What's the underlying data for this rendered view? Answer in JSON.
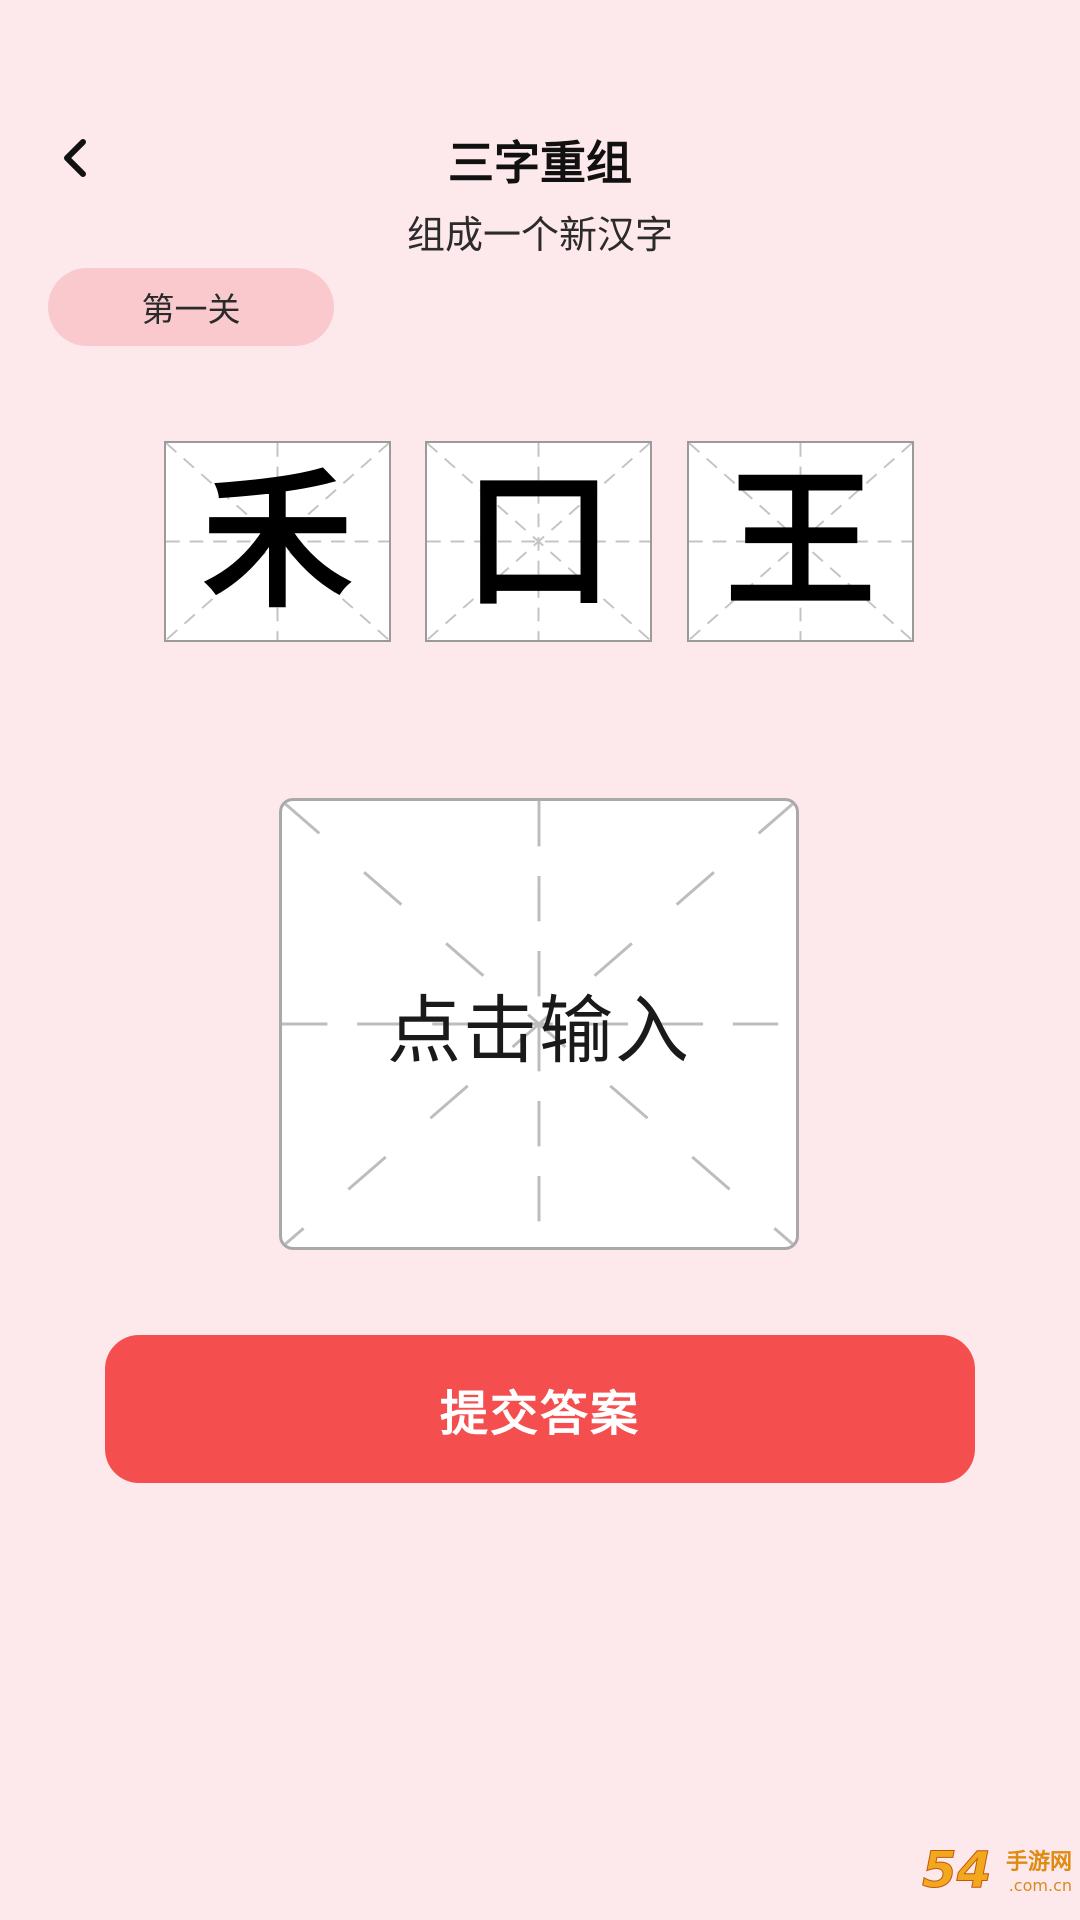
{
  "header": {
    "back_icon": "chevron-left-icon",
    "title": "三字重组",
    "subtitle": "组成一个新汉字"
  },
  "level": {
    "label": "第一关"
  },
  "tiles": [
    {
      "char": "禾"
    },
    {
      "char": "口"
    },
    {
      "char": "王"
    }
  ],
  "answer": {
    "placeholder": "点击输入"
  },
  "submit": {
    "label": "提交答案"
  },
  "watermark": {
    "number": "54",
    "brand": "手游网",
    "url": ".com.cn"
  },
  "colors": {
    "background": "#fde8eb",
    "badge": "#f9c9cd",
    "submit": "#f54e4e",
    "grid_line": "#bdbdbd"
  }
}
